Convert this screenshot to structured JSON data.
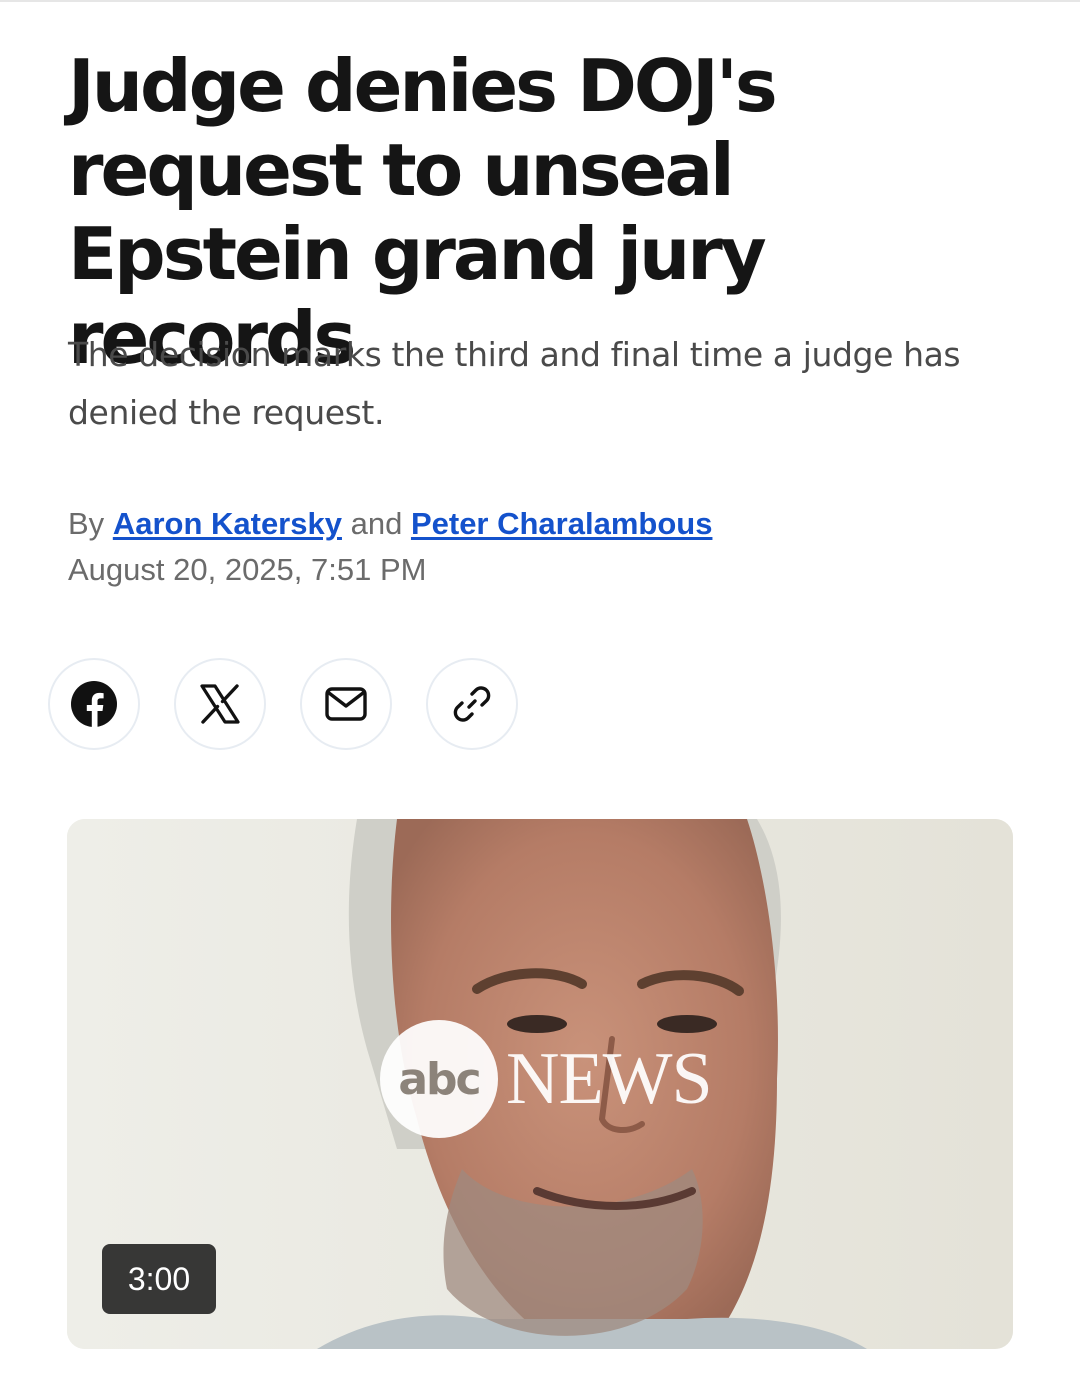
{
  "article": {
    "headline": "Judge denies DOJ's request to unseal Epstein grand jury records",
    "subheadline": "The decision marks the third and final time a judge has denied the request.",
    "byline": {
      "prefix": "By",
      "author1": "Aaron Katersky",
      "conjunction": "and",
      "author2": "Peter Charalambous"
    },
    "timestamp": "August 20, 2025, 7:51 PM"
  },
  "share": {
    "buttons": [
      {
        "name": "facebook",
        "icon": "facebook-icon"
      },
      {
        "name": "x",
        "icon": "x-icon"
      },
      {
        "name": "email",
        "icon": "mail-icon"
      },
      {
        "name": "copy-link",
        "icon": "link-icon"
      }
    ]
  },
  "video": {
    "duration": "3:00",
    "logo": {
      "circle_text": "abc",
      "word": "NEWS"
    }
  },
  "colors": {
    "link": "#1452cc",
    "headline": "#151515",
    "meta": "#6b6b6b"
  }
}
